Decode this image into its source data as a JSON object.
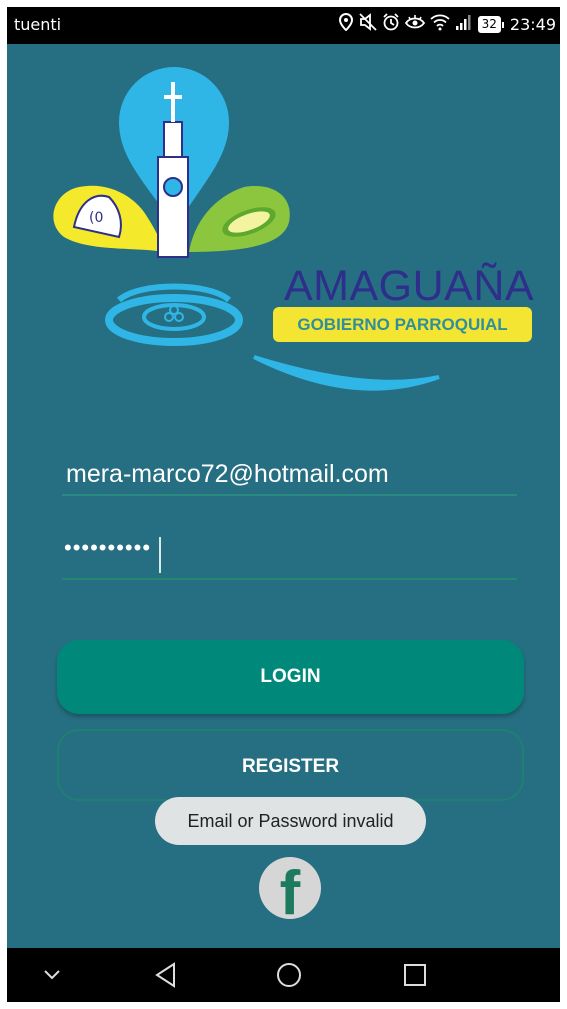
{
  "status_bar": {
    "carrier": "tuenti",
    "battery": "32",
    "time": "23:49",
    "icons": [
      "location-icon",
      "mute-icon",
      "alarm-icon",
      "eye-comfort-icon",
      "wifi-icon",
      "signal-icon",
      "battery-icon"
    ]
  },
  "logo": {
    "brand_name": "AMAGUAÑA",
    "subtitle": "GOBIERNO PARROQUIAL"
  },
  "form": {
    "email_value": "mera-marco72@hotmail.com",
    "password_value": "••••••••••",
    "login_label": "LOGIN",
    "register_label": "REGISTER"
  },
  "toast": {
    "message": "Email or Password invalid"
  },
  "social": {
    "facebook_glyph": "f"
  },
  "nav_bar": {
    "icons": [
      "chevron-down-icon",
      "back-icon",
      "home-icon",
      "recents-icon"
    ]
  },
  "colors": {
    "background": "#266f82",
    "accent": "#00897b",
    "brand_blue": "#2e2f8a",
    "pill_yellow": "#f5e533",
    "toast_bg": "#dfe3e3"
  }
}
